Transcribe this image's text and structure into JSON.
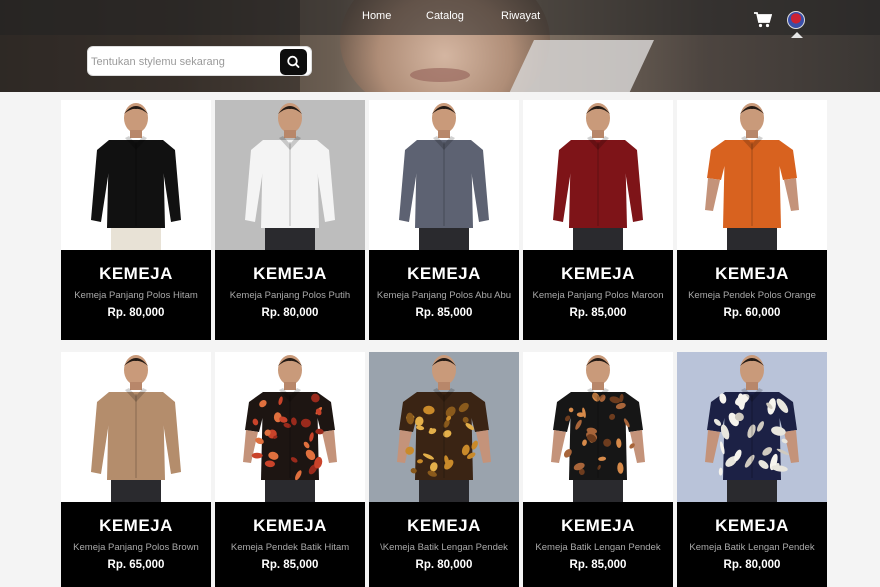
{
  "nav": {
    "links": [
      "Home",
      "Catalog",
      "Riwayat"
    ]
  },
  "search": {
    "placeholder": "Tentukan stylemu sekarang"
  },
  "products": [
    {
      "category": "KEMEJA",
      "name": "Kemeja Panjang Polos Hitam",
      "price": "Rp. 80,000",
      "bg": "#ffffff",
      "shirt": "#111111",
      "pattern": "solid",
      "sleeve": "long"
    },
    {
      "category": "KEMEJA",
      "name": "Kemeja Panjang Polos Putih",
      "price": "Rp. 80,000",
      "bg": "#bdbdbd",
      "shirt": "#f4f4f4",
      "pattern": "solid",
      "sleeve": "long"
    },
    {
      "category": "KEMEJA",
      "name": "Kemeja Panjang Polos Abu Abu",
      "price": "Rp. 85,000",
      "bg": "#ffffff",
      "shirt": "#5d6272",
      "pattern": "solid",
      "sleeve": "long"
    },
    {
      "category": "KEMEJA",
      "name": "Kemeja Panjang Polos Maroon",
      "price": "Rp. 85,000",
      "bg": "#ffffff",
      "shirt": "#7e1418",
      "pattern": "solid",
      "sleeve": "long"
    },
    {
      "category": "KEMEJA",
      "name": "Kemeja Pendek Polos Orange",
      "price": "Rp. 60,000",
      "bg": "#ffffff",
      "shirt": "#d8621f",
      "pattern": "solid",
      "sleeve": "short"
    },
    {
      "category": "KEMEJA",
      "name": "Kemeja Panjang Polos Brown",
      "price": "Rp. 65,000",
      "bg": "#ffffff",
      "shirt": "#b48d6c",
      "pattern": "solid",
      "sleeve": "long"
    },
    {
      "category": "KEMEJA",
      "name": "Kemeja Pendek Batik Hitam",
      "price": "Rp. 85,000",
      "bg": "#ffffff",
      "shirt": "#1d1512",
      "pattern": "batik-red",
      "sleeve": "short"
    },
    {
      "category": "KEMEJA",
      "name": "\\Kemeja Batik Lengan Pendek",
      "price": "Rp. 80,000",
      "bg": "#9aa3ad",
      "shirt": "#3a2414",
      "pattern": "batik-gold",
      "sleeve": "short"
    },
    {
      "category": "KEMEJA",
      "name": "Kemeja Batik Lengan Pendek",
      "price": "Rp. 85,000",
      "bg": "#ffffff",
      "shirt": "#161616",
      "pattern": "batik-brown",
      "sleeve": "short"
    },
    {
      "category": "KEMEJA",
      "name": "Kemeja Batik Lengan Pendek",
      "price": "Rp. 80,000",
      "bg": "#b9c3d9",
      "shirt": "#1c2145",
      "pattern": "leaf-white",
      "sleeve": "short"
    }
  ]
}
